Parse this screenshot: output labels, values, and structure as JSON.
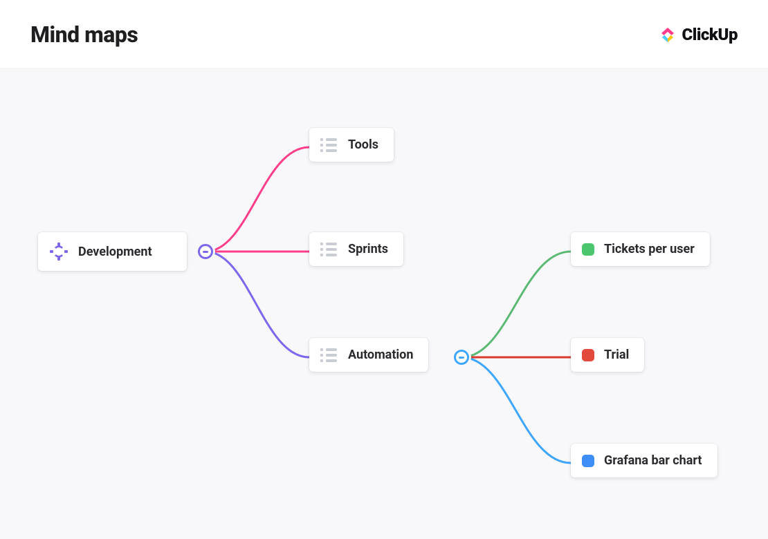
{
  "header": {
    "title": "Mind maps",
    "brand_name": "ClickUp"
  },
  "nodes": {
    "root": {
      "label": "Development",
      "icon": "globe-icon"
    },
    "tools": {
      "label": "Tools",
      "icon": "list-icon"
    },
    "sprints": {
      "label": "Sprints",
      "icon": "list-icon"
    },
    "automation": {
      "label": "Automation",
      "icon": "list-icon"
    },
    "tickets_per_user": {
      "label": "Tickets per user",
      "color": "#4cc66d"
    },
    "trial": {
      "label": "Trial",
      "color": "#e24b3b"
    },
    "grafana": {
      "label": "Grafana bar chart",
      "color": "#3e8ef7"
    }
  },
  "edges": {
    "root_to_tools": "#ff3d8b",
    "root_to_sprints": "#ff3d8b",
    "root_to_automation": "#7b68ee",
    "automation_to_tickets": "#5bb974",
    "automation_to_trial": "#e24b3b",
    "automation_to_grafana": "#3ea6ff"
  }
}
